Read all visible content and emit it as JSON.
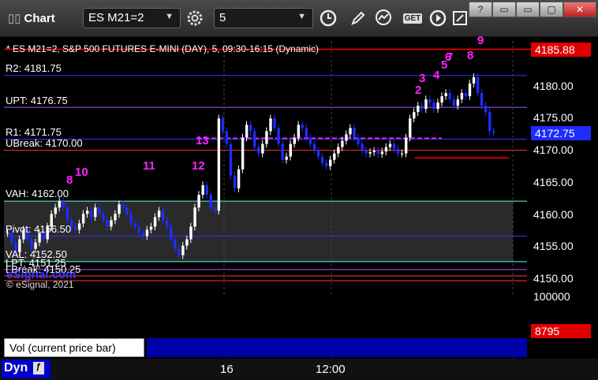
{
  "toolbar": {
    "title": "Chart",
    "symbol": "ES M21=2",
    "interval": "5",
    "get_label": "GET"
  },
  "window_controls": [
    "?",
    "▭",
    "▭",
    "▢",
    "✕"
  ],
  "chart": {
    "header": "* ES M21=2, S&P 500 FUTURES E-MINI (DAY), 5, 09:30-16:15 (Dynamic)",
    "levels": [
      {
        "label": "R2: 4181.75",
        "value": 4181.75
      },
      {
        "label": "UPT: 4176.75",
        "value": 4176.75
      },
      {
        "label": "R1: 4171.75",
        "value": 4171.75
      },
      {
        "label": "UBreak: 4170.00",
        "value": 4170.0
      },
      {
        "label": "VAH: 4162.00",
        "value": 4162.0
      },
      {
        "label": "Pivot: 4156.50",
        "value": 4156.5
      },
      {
        "label": "VAL: 4152.50",
        "value": 4152.5
      },
      {
        "label": "LPT: 4151.25",
        "value": 4151.25
      },
      {
        "label": "LBreak: 4150.25",
        "value": 4150.25
      }
    ],
    "copyright": "© eSignal, 2021",
    "watermark": "eSignal.com",
    "price_ticks": [
      "4180.00",
      "4175.00",
      "4170.00",
      "4165.00",
      "4160.00",
      "4155.00",
      "4150.00"
    ],
    "top_tag": "4185.88",
    "last_tag": "4172.75",
    "counts": [
      "8",
      "10",
      "11",
      "12",
      "13",
      "2",
      "3",
      "4",
      "5",
      "6",
      "7",
      "8",
      "9"
    ],
    "time_labels": [
      "16",
      "12:00"
    ],
    "colors": {
      "up": "#ffffff",
      "down": "#1e2cff",
      "magenta": "#ff22ff",
      "red": "#ff0000"
    }
  },
  "volume": {
    "label": "Vol (current price bar)",
    "tick": "100000",
    "last_tag": "8795"
  },
  "footer": {
    "dyn_label": "Dyn"
  }
}
